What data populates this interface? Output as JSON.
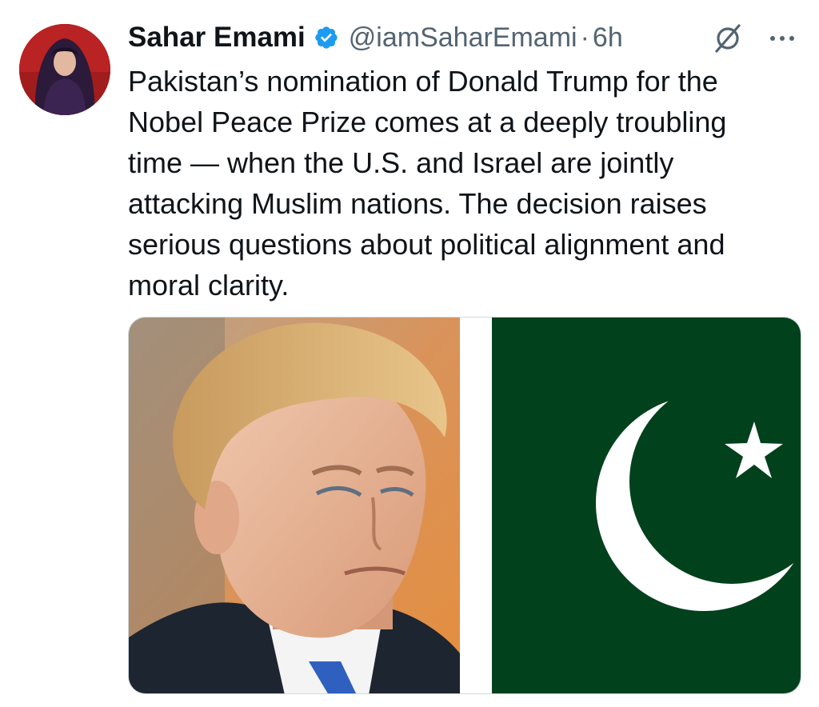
{
  "tweet": {
    "author": {
      "name": "Sahar Emami",
      "handle": "@iamSaharEmami",
      "verified": true,
      "avatar_icon": "avatar-photo"
    },
    "separator": "·",
    "time": "6h",
    "grok_icon": "grok-icon",
    "more_icon": "more-dots-icon",
    "text_lines": [
      "Pakistan’s nomination of Donald Trump for the",
      "Nobel Peace Prize comes at a deeply troubling",
      "time — when the U.S. and Israel are jointly",
      "attacking Muslim nations. The decision raises",
      "serious questions about political alignment and",
      "moral clarity."
    ],
    "media": {
      "left_image": "portrait-photo",
      "right_image": "pakistan-flag"
    }
  },
  "colors": {
    "verified_blue": "#1d9bf0",
    "secondary_text": "#536471",
    "flag_green": "#01411c",
    "avatar_bg": "#a11c1c"
  }
}
